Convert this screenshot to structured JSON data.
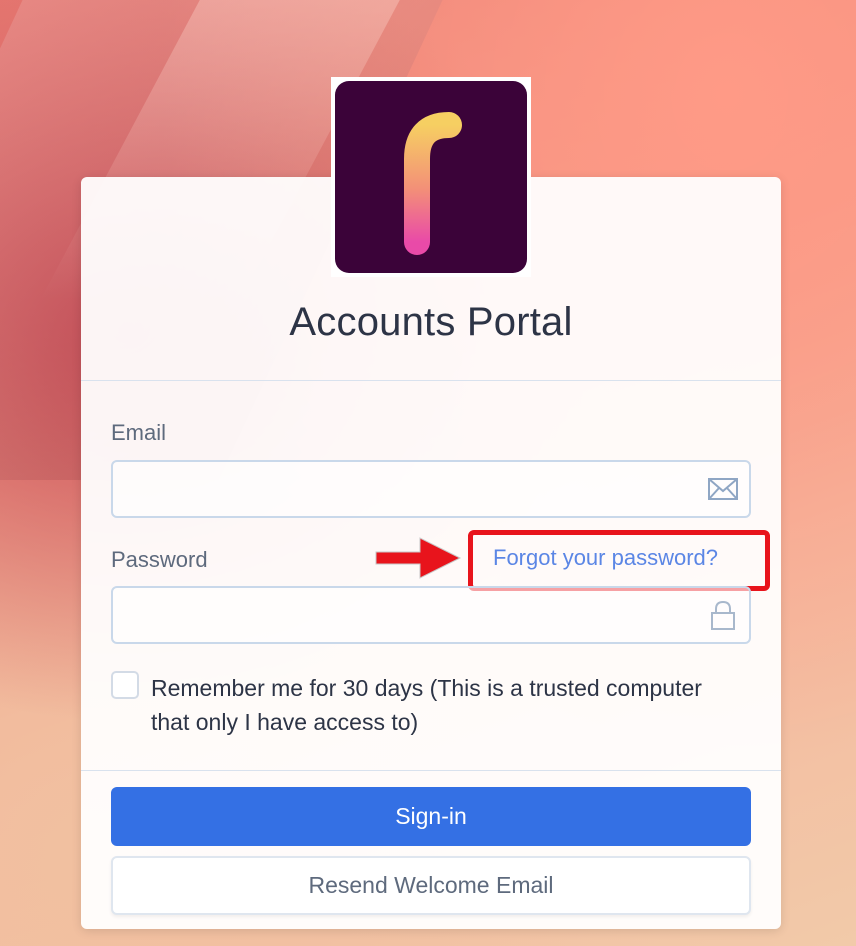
{
  "app": {
    "title": "Accounts Portal",
    "logo_letter": "f"
  },
  "form": {
    "email": {
      "label": "Email",
      "value": "",
      "placeholder": ""
    },
    "password": {
      "label": "Password",
      "value": "",
      "placeholder": ""
    },
    "forgot_link": "Forgot your password?",
    "remember": {
      "label": "Remember me for 30 days (This is a trusted computer that only I have access to)",
      "checked": false
    }
  },
  "actions": {
    "signin_label": "Sign-in",
    "resend_label": "Resend Welcome Email"
  },
  "annotation": {
    "color": "#e8141c"
  },
  "colors": {
    "primary": "#3470e4",
    "link": "#5b86e5",
    "logo_bg": "#3b0339"
  }
}
